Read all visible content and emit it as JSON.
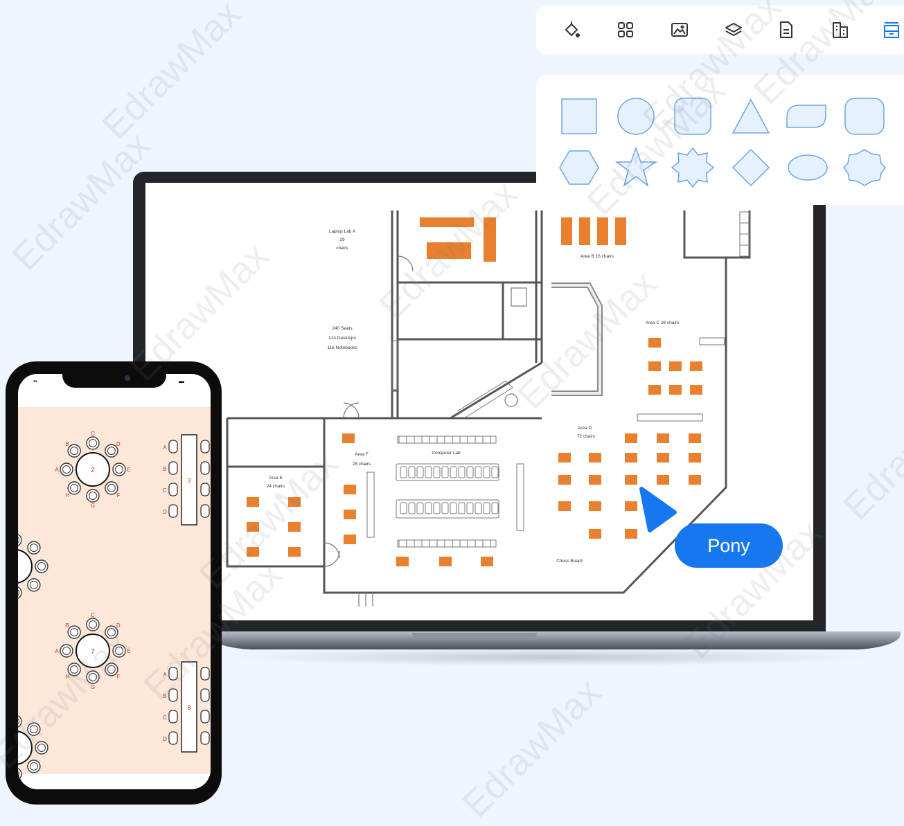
{
  "toolbar": {
    "tools": [
      {
        "name": "fill-bucket-icon"
      },
      {
        "name": "grid-icon"
      },
      {
        "name": "image-icon"
      },
      {
        "name": "layers-icon"
      },
      {
        "name": "document-icon"
      },
      {
        "name": "building-icon"
      },
      {
        "name": "archive-icon"
      }
    ],
    "active_color": "#1677f0"
  },
  "shapes": [
    "square",
    "circle",
    "rounded-square",
    "triangle",
    "data-shape",
    "rounded-rectangle",
    "hexagon",
    "star",
    "octagram",
    "diamond",
    "ellipse",
    "badge"
  ],
  "floor_plan": {
    "labels": {
      "laptop_lab": [
        "Laptop Lab A",
        "29",
        "chairs"
      ],
      "area_b": "Area B 16 chairs",
      "seats": [
        "240 Seats",
        "124 Desktops",
        "116 Notebooks"
      ],
      "area_c": "Area C 28 chairs",
      "area_d": [
        "Area D",
        "72 chairs"
      ],
      "area_f": [
        "Area F",
        "28 chairs"
      ],
      "computer_lab": "Computer Lab",
      "area_e": [
        "Area E",
        "24 chairs"
      ],
      "chess_board": "Chess Board"
    },
    "furniture_color": "#e8802f"
  },
  "phone": {
    "tables": [
      "2",
      "3",
      "7",
      "8"
    ],
    "seat_letters": [
      "A",
      "B",
      "C",
      "D",
      "E",
      "F",
      "G",
      "H"
    ],
    "background": "#fde7d9"
  },
  "cursor": {
    "label": "Pony",
    "color": "#1677f0"
  },
  "watermark": "EdrawMax"
}
